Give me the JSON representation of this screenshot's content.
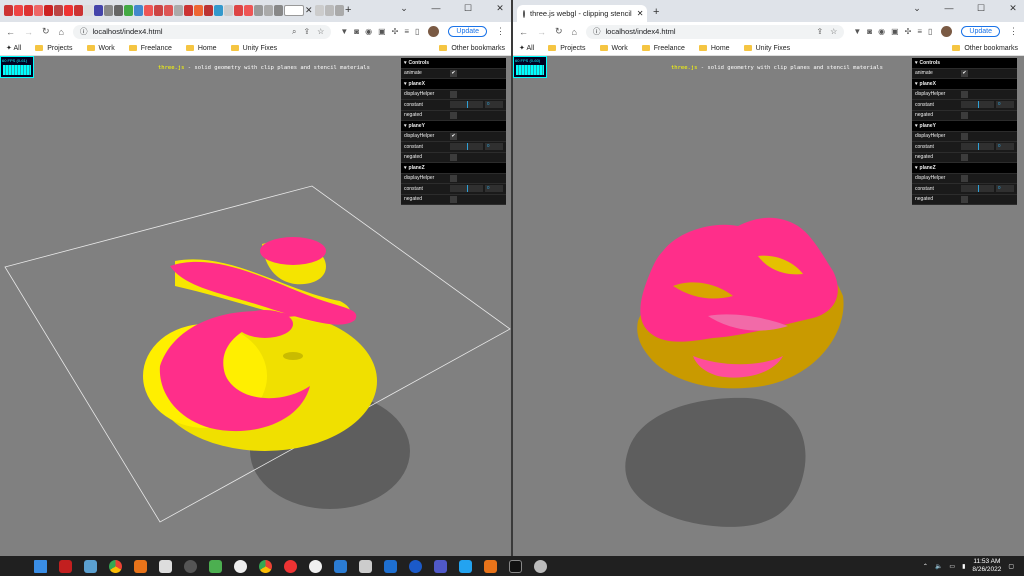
{
  "window1": {
    "tab_title": "",
    "url": "localhost/index4.html",
    "update_label": "Update"
  },
  "window2": {
    "tab_title": "three.js webgl - clipping stencil",
    "url": "localhost/index4.html",
    "update_label": "Update"
  },
  "bookmarks": {
    "all": "All",
    "items": [
      "Projects",
      "Work",
      "Freelance",
      "Home",
      "Unity Fixes"
    ],
    "other": "Other bookmarks"
  },
  "scene": {
    "info_link": "three.js",
    "info_text": " - solid geometry with clip planes and stencil materials",
    "stats_label": "60 FPS (0-61)",
    "stats_label2": "60 FPS (0-60)"
  },
  "gui": {
    "title": "Controls",
    "animate_label": "animate",
    "sections": [
      {
        "name": "planeX",
        "displayHelper": false
      },
      {
        "name": "planeY",
        "displayHelper": true
      },
      {
        "name": "planeZ",
        "displayHelper": false
      }
    ],
    "displayHelper_label": "displayHelper",
    "constant_label": "constant",
    "negated_label": "negated",
    "constant_value": "0",
    "check": "✔"
  },
  "taskbar": {
    "time": "11:53 AM",
    "date": "8/26/2022"
  },
  "icons": {
    "back": "back-icon",
    "forward": "forward-icon",
    "reload": "reload-icon",
    "home": "home-icon"
  }
}
